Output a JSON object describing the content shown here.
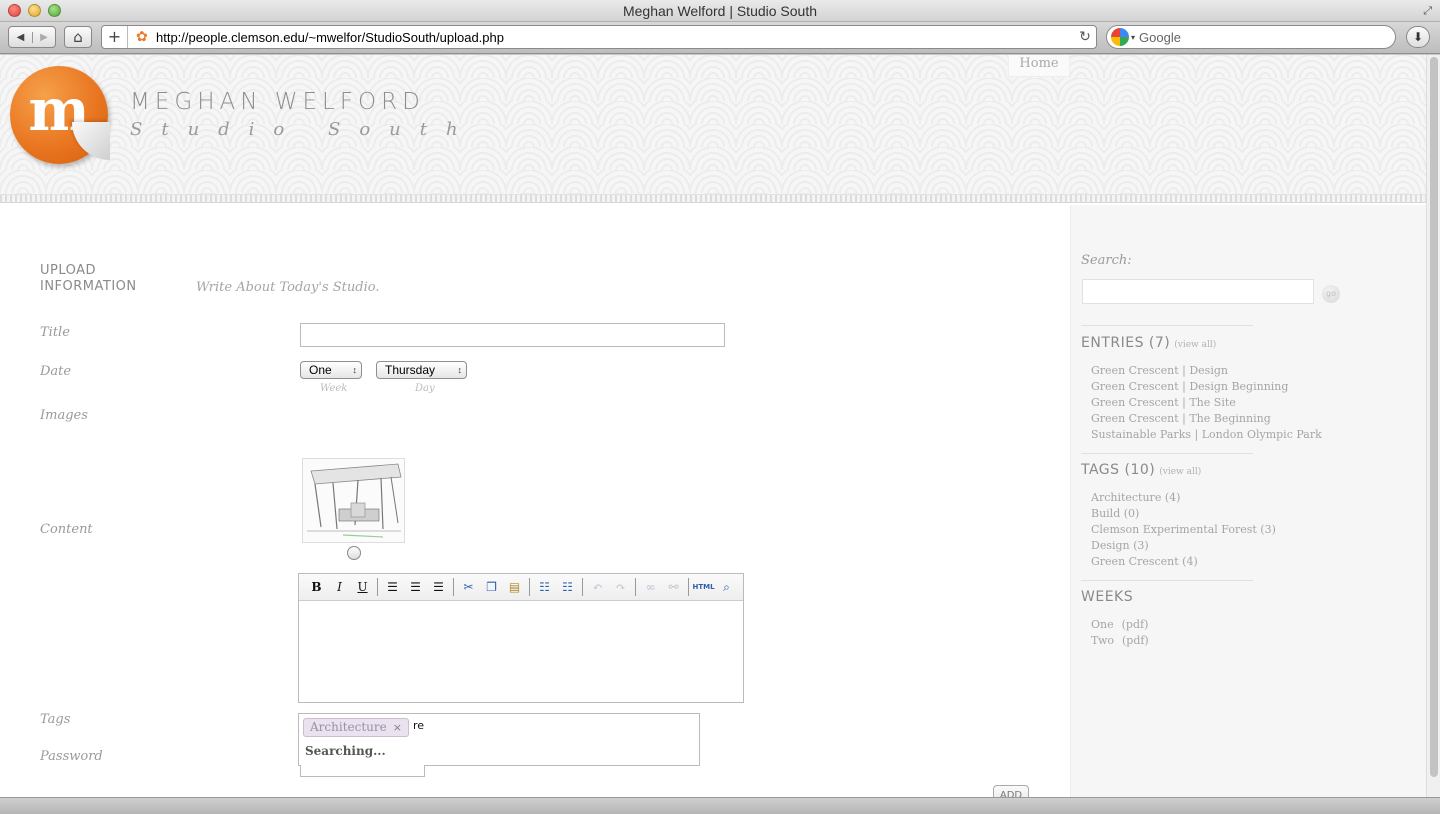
{
  "browser": {
    "window_title": "Meghan Welford | Studio South",
    "url": "http://people.clemson.edu/~mwelfor/StudioSouth/upload.php",
    "search_placeholder": "Google"
  },
  "header": {
    "logo_letter": "m",
    "site_name": "MEGHAN WELFORD",
    "tagline": "Studio South",
    "nav": [
      {
        "label": "Home"
      }
    ]
  },
  "form": {
    "heading": "UPLOAD INFORMATION",
    "subheading": "Write About Today's Studio.",
    "labels": {
      "title": "Title",
      "date": "Date",
      "images": "Images",
      "content": "Content",
      "tags": "Tags",
      "password": "Password"
    },
    "title_value": "",
    "week_value": "One",
    "week_caption": "Week",
    "day_value": "Thursday",
    "day_caption": "Day",
    "editor_toolbar": [
      "bold",
      "italic",
      "underline",
      "align-left",
      "align-center",
      "align-right",
      "cut",
      "copy",
      "paste",
      "bullet-list",
      "numbered-list",
      "undo",
      "redo",
      "link",
      "unlink",
      "html",
      "preview"
    ],
    "editor_html_label": "HTML",
    "tag_chip": "Architecture",
    "tag_chip_remove": "×",
    "tag_typed": "re",
    "tag_status": "Searching...",
    "add_button": "ADD"
  },
  "sidebar": {
    "search_label": "Search:",
    "search_go": "go",
    "entries_heading": "ENTRIES (7)",
    "entries_view_all": "(view all)",
    "entries": [
      "Green Crescent | Design",
      "Green Crescent | Design Beginning",
      "Green Crescent | The Site",
      "Green Crescent | The Beginning",
      "Sustainable Parks | London Olympic Park"
    ],
    "tags_heading": "TAGS (10)",
    "tags_view_all": "(view all)",
    "tags": [
      "Architecture (4)",
      "Build (0)",
      "Clemson Experimental Forest (3)",
      "Design (3)",
      "Green Crescent (4)"
    ],
    "weeks_heading": "WEEKS",
    "weeks": [
      {
        "name": "One",
        "link": "(pdf)"
      },
      {
        "name": "Two",
        "link": "(pdf)"
      }
    ]
  }
}
